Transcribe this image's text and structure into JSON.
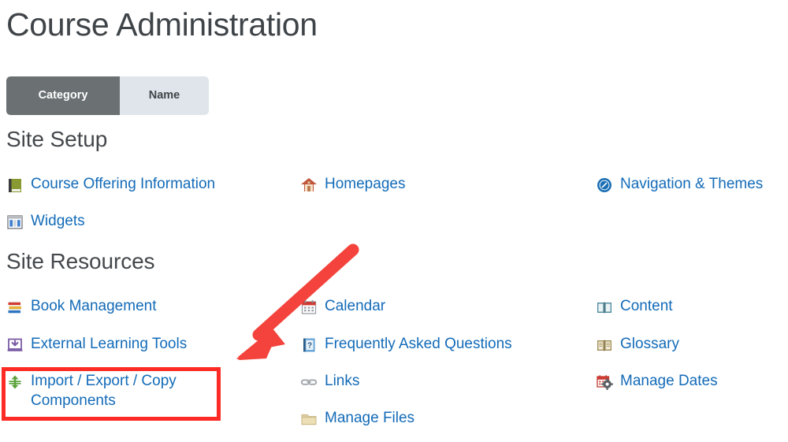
{
  "page": {
    "title": "Course Administration"
  },
  "view_toggle": {
    "name": "sort-view-toggle",
    "options": [
      {
        "label": "Category",
        "state": "active"
      },
      {
        "label": "Name",
        "state": "inactive"
      }
    ]
  },
  "sections": [
    {
      "heading": "Site Setup",
      "items": [
        {
          "label": "Course Offering Information",
          "icon": "green-book-icon",
          "column": 0,
          "row": 0
        },
        {
          "label": "Homepages",
          "icon": "house-icon",
          "column": 1,
          "row": 0
        },
        {
          "label": "Navigation & Themes",
          "icon": "compass-icon",
          "column": 2,
          "row": 0
        },
        {
          "label": "Widgets",
          "icon": "window-panels-icon",
          "column": 0,
          "row": 1
        }
      ]
    },
    {
      "heading": "Site Resources",
      "items": [
        {
          "label": "Book Management",
          "icon": "stacked-books-icon",
          "column": 0,
          "row": 0
        },
        {
          "label": "Calendar",
          "icon": "calendar-icon",
          "column": 1,
          "row": 0
        },
        {
          "label": "Content",
          "icon": "open-book-blue-icon",
          "column": 2,
          "row": 0
        },
        {
          "label": "External Learning Tools",
          "icon": "external-tool-icon",
          "column": 0,
          "row": 1
        },
        {
          "label": "Frequently Asked Questions",
          "icon": "question-page-icon",
          "column": 1,
          "row": 1
        },
        {
          "label": "Glossary",
          "icon": "open-book-tan-icon",
          "column": 2,
          "row": 1
        },
        {
          "label": "Import / Export / Copy Components",
          "icon": "import-export-arrows-icon",
          "column": 0,
          "row": 2
        },
        {
          "label": "Links",
          "icon": "chain-link-icon",
          "column": 1,
          "row": 2
        },
        {
          "label": "Manage Dates",
          "icon": "calendar-gear-icon",
          "column": 2,
          "row": 2
        },
        {
          "label": "Manage Files",
          "icon": "folder-icon",
          "column": 1,
          "row": 3
        }
      ]
    }
  ],
  "annotations": {
    "highlight_box": {
      "target": "Import / Export / Copy Components",
      "color": "#fc2b25"
    },
    "arrow": {
      "color": "#f4433c",
      "direction": "down-left"
    }
  },
  "colors": {
    "link": "#136bb8",
    "heading": "#44484c",
    "toggle_active_bg": "#6b7073",
    "toggle_inactive_bg": "#dfe5ea",
    "annotation_red": "#fc2b25"
  }
}
